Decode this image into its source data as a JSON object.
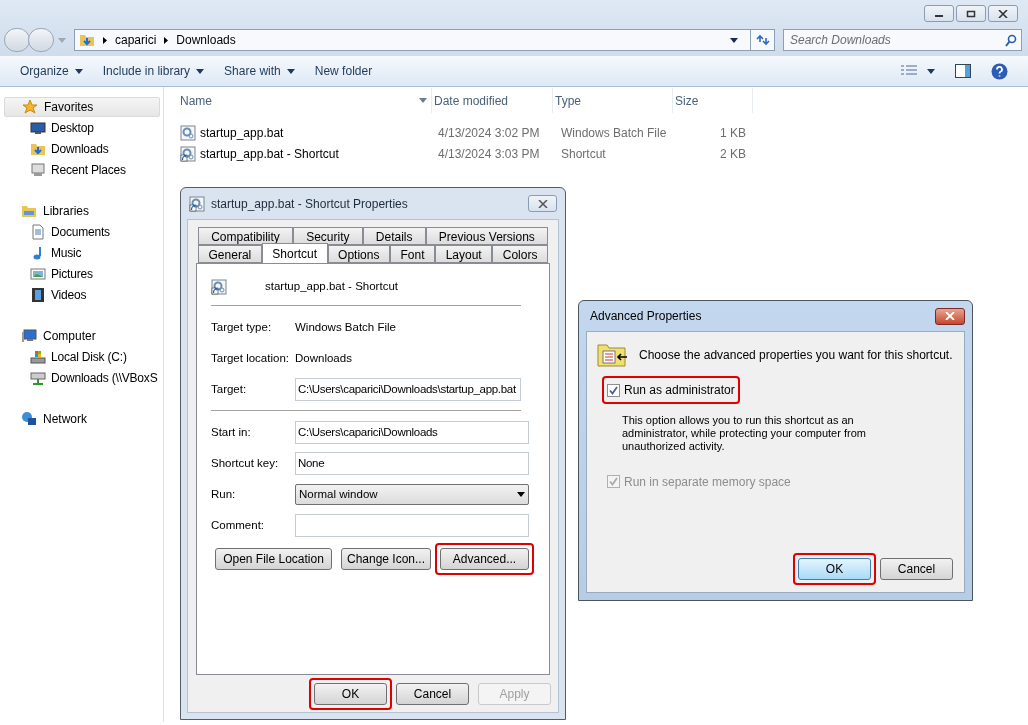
{
  "explorer": {
    "address": [
      "caparici",
      "Downloads"
    ],
    "search": {
      "placeholder": "Search Downloads"
    },
    "toolbar": [
      {
        "label": "Organize",
        "has_menu": true
      },
      {
        "label": "Include in library",
        "has_menu": true
      },
      {
        "label": "Share with",
        "has_menu": true
      },
      {
        "label": "New folder",
        "has_menu": false
      }
    ],
    "sidebar": [
      {
        "label": "Favorites",
        "kind": "star",
        "selected": true,
        "children": [
          {
            "label": "Desktop",
            "kind": "desktop",
            "selected": false
          },
          {
            "label": "Downloads",
            "kind": "download-folder",
            "selected": false
          },
          {
            "label": "Recent Places",
            "kind": "recent",
            "selected": false
          }
        ]
      },
      {
        "label": "Libraries",
        "kind": "library",
        "selected": false,
        "children": [
          {
            "label": "Documents",
            "kind": "document",
            "selected": false
          },
          {
            "label": "Music",
            "kind": "music",
            "selected": false
          },
          {
            "label": "Pictures",
            "kind": "picture",
            "selected": false
          },
          {
            "label": "Videos",
            "kind": "video",
            "selected": false
          }
        ]
      },
      {
        "label": "Computer",
        "kind": "computer",
        "selected": false,
        "children": [
          {
            "label": "Local Disk (C:)",
            "kind": "disk",
            "selected": false
          },
          {
            "label": "Downloads (\\\\VBoxS",
            "kind": "network-drive",
            "selected": false
          }
        ]
      },
      {
        "label": "Network",
        "kind": "network",
        "selected": false
      }
    ],
    "columns": [
      "Name",
      "Date modified",
      "Type",
      "Size"
    ],
    "rows": [
      {
        "kind": "batch",
        "name": "startup_app.bat",
        "date": "4/13/2024 3:02 PM",
        "type": "Windows Batch File",
        "size": "1 KB"
      },
      {
        "kind": "shortcut",
        "name": "startup_app.bat - Shortcut",
        "date": "4/13/2024 3:03 PM",
        "type": "Shortcut",
        "size": "2 KB"
      }
    ]
  },
  "properties": {
    "title": "startup_app.bat - Shortcut Properties",
    "tab_rows": [
      [
        {
          "label": "Compatibility",
          "selected": false
        },
        {
          "label": "Security",
          "selected": false
        },
        {
          "label": "Details",
          "selected": false
        },
        {
          "label": "Previous Versions",
          "selected": false
        }
      ],
      [
        {
          "label": "General",
          "selected": false
        },
        {
          "label": "Shortcut",
          "selected": true
        },
        {
          "label": "Options",
          "selected": false
        },
        {
          "label": "Font",
          "selected": false
        },
        {
          "label": "Layout",
          "selected": false
        },
        {
          "label": "Colors",
          "selected": false
        }
      ]
    ],
    "header": "startup_app.bat - Shortcut",
    "sections": [
      [
        {
          "kind": "text",
          "label": "Target type:",
          "value": "Windows Batch File"
        },
        {
          "kind": "text",
          "label": "Target location:",
          "value": "Downloads"
        },
        {
          "kind": "input",
          "label": "Target:",
          "value": "C:\\Users\\caparici\\Downloads\\startup_app.bat"
        }
      ],
      [
        {
          "kind": "input",
          "label": "Start in:",
          "value": "C:\\Users\\caparici\\Downloads"
        },
        {
          "kind": "input",
          "label": "Shortcut key:",
          "value": "None"
        },
        {
          "kind": "select",
          "label": "Run:",
          "value": "Normal window"
        },
        {
          "kind": "input",
          "label": "Comment:"
        }
      ]
    ],
    "actions": [
      {
        "label": "Open File Location",
        "highlighted": false
      },
      {
        "label": "Change Icon...",
        "highlighted": false
      },
      {
        "label": "Advanced...",
        "highlighted": true
      }
    ],
    "footer": [
      {
        "label": "OK",
        "disabled": false,
        "highlighted": true
      },
      {
        "label": "Cancel",
        "disabled": false,
        "highlighted": false
      },
      {
        "label": "Apply",
        "disabled": true,
        "highlighted": false
      }
    ]
  },
  "advanced": {
    "title": "Advanced Properties",
    "prompt": "Choose the advanced properties you want for this shortcut.",
    "options": [
      {
        "label": "Run as administrator",
        "checked": true,
        "disabled": false,
        "highlighted": true,
        "description": "This option allows you to run this shortcut as an administrator, while protecting your computer from unauthorized activity."
      },
      {
        "label": "Run in separate memory space",
        "checked": true,
        "disabled": true,
        "highlighted": false
      }
    ],
    "buttons": [
      {
        "label": "OK",
        "default": true,
        "highlighted": true
      },
      {
        "label": "Cancel",
        "default": false,
        "highlighted": false
      }
    ]
  }
}
